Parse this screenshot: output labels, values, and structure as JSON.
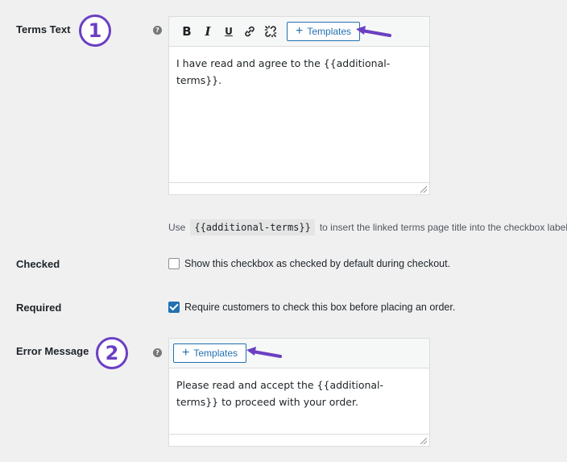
{
  "terms_text": {
    "label": "Terms Text",
    "step": "1",
    "help_icon": "?",
    "toolbar": {
      "bold": "B",
      "italic": "I",
      "underline": "U",
      "link_icon": "link-icon",
      "unlink_icon": "unlink-icon",
      "templates_plus": "+",
      "templates_label": "Templates"
    },
    "content": "I have read and agree to the {{additional-terms}}."
  },
  "help_line": {
    "before": "Use",
    "code": "{{additional-terms}}",
    "after": "to insert the linked terms page title into the checkbox label."
  },
  "checked": {
    "label": "Checked",
    "checkbox_label": "Show this checkbox as checked by default during checkout.",
    "value": false
  },
  "required": {
    "label": "Required",
    "checkbox_label": "Require customers to check this box before placing an order.",
    "value": true
  },
  "error_message": {
    "label": "Error Message",
    "step": "2",
    "help_icon": "?",
    "templates_plus": "+",
    "templates_label": "Templates",
    "content": "Please read and accept the {{additional-terms}} to proceed with your order."
  },
  "colors": {
    "accent": "#2271b1",
    "annotation": "#6b3fc2"
  }
}
